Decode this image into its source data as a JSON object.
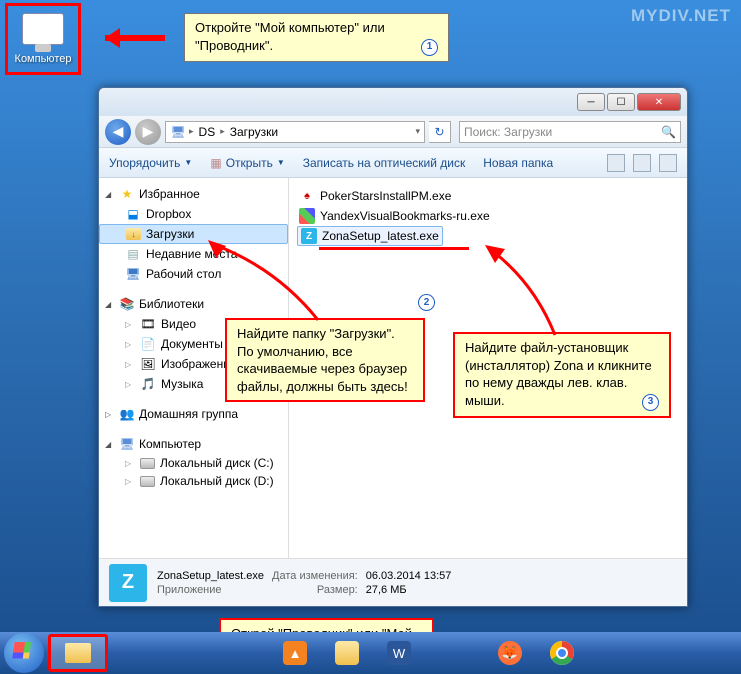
{
  "watermark": "MYDIV.NET",
  "desktop": {
    "computer_label": "Компьютер"
  },
  "callouts": {
    "c1": "Откройте \"Мой компьютер\" или \"Проводник\".",
    "c2": "Найдите папку \"Загрузки\". По умолчанию, все скачиваемые через браузер файлы, должны быть здесь!",
    "c3": "Найдите файл-установщик (инсталлятор) Zona и кликните по нему дважды лев. клав. мыши.",
    "c4": "Открой \"Проводник\" или \"Мой компьютер\"."
  },
  "breadcrumb": {
    "seg1": "DS",
    "seg2": "Загрузки"
  },
  "search_placeholder": "Поиск: Загрузки",
  "toolbar": {
    "organize": "Упорядочить",
    "open": "Открыть",
    "burn": "Записать на оптический диск",
    "newfolder": "Новая папка"
  },
  "sidebar": {
    "favorites": "Избранное",
    "dropbox": "Dropbox",
    "downloads": "Загрузки",
    "recent": "Недавние места",
    "desktop": "Рабочий стол",
    "libraries": "Библиотеки",
    "video": "Видео",
    "documents": "Документы",
    "pictures": "Изображения",
    "music": "Музыка",
    "homegroup": "Домашняя группа",
    "computer": "Компьютер",
    "diskC": "Локальный диск (C:)",
    "diskD": "Локальный диск (D:)"
  },
  "files": {
    "f1": "PokerStarsInstallPM.exe",
    "f2": "YandexVisualBookmarks-ru.exe",
    "f3": "ZonaSetup_latest.exe"
  },
  "status": {
    "filename": "ZonaSetup_latest.exe",
    "type": "Приложение",
    "date_lbl": "Дата изменения:",
    "date_val": "06.03.2014 13:57",
    "size_lbl": "Размер:",
    "size_val": "27,6 МБ"
  }
}
